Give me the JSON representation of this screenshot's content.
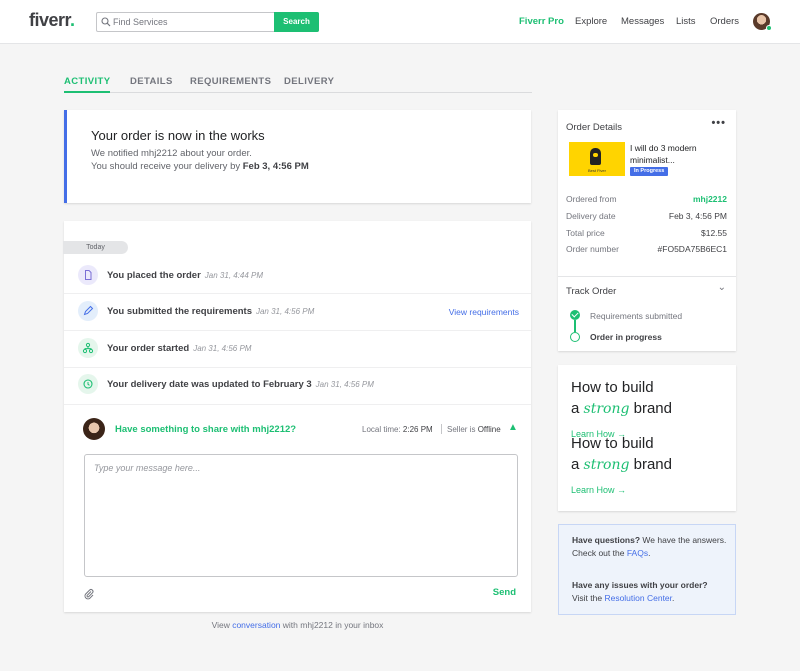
{
  "header": {
    "logo": "fiverr",
    "logo_dot": ".",
    "search_placeholder": "Find Services",
    "search_button": "Search",
    "nav": [
      "Fiverr Pro",
      "Explore",
      "Messages",
      "Lists",
      "Orders"
    ]
  },
  "tabs": [
    "ACTIVITY",
    "DETAILS",
    "REQUIREMENTS",
    "DELIVERY"
  ],
  "status": {
    "title": "Your order is now in the works",
    "line1": "We notified mhj2212 about your order.",
    "line2_prefix": "You should receive your delivery by ",
    "line2_date": "Feb 3, 4:56 PM"
  },
  "activity": {
    "day_label": "Today",
    "events": [
      {
        "text": "You placed the order",
        "date": "Jan 31, 4:44 PM",
        "icon": "document-icon"
      },
      {
        "text": "You submitted the requirements",
        "date": "Jan 31, 4:56 PM",
        "icon": "pencil-icon",
        "link": "View requirements"
      },
      {
        "text": "Your order started",
        "date": "Jan 31, 4:56 PM",
        "icon": "hierarchy-icon"
      },
      {
        "text": "Your delivery date was updated to February 3",
        "date": "Jan 31, 4:56 PM",
        "icon": "clock-icon"
      }
    ],
    "message": {
      "prompt": "Have something to share with mhj2212?",
      "local_time_label": "Local time:",
      "local_time": "2:26 PM",
      "seller_label": "Seller is",
      "seller_status": "Offline",
      "placeholder": "Type your message here...",
      "send": "Send"
    },
    "inbox_prefix": "View ",
    "inbox_link": "conversation",
    "inbox_suffix": " with mhj2212 in your inbox"
  },
  "order": {
    "header": "Order Details",
    "more": "•••",
    "gig_title": "I will do 3 modern minimalist...",
    "gig_thumb_caption": "Best Fiver",
    "badge": "In Progress",
    "rows": [
      {
        "k": "Ordered from",
        "v": "mhj2212"
      },
      {
        "k": "Delivery date",
        "v": "Feb 3, 4:56 PM"
      },
      {
        "k": "Total price",
        "v": "$12.55"
      },
      {
        "k": "Order number",
        "v": "#FO5DA75B6EC1"
      }
    ],
    "track": "Track Order",
    "steps": [
      "Requirements submitted",
      "Order in progress"
    ]
  },
  "promo": {
    "line1": "How to build",
    "line2_a": "a ",
    "line2_em": "strong",
    "line2_b": " brand",
    "link": "Learn How →"
  },
  "help": {
    "q1_bold": "Have questions?",
    "q1_rest": " We have the answers.",
    "q1_pre": "Check out the ",
    "q1_link": "FAQs",
    "q1_post": ".",
    "q2_bold": "Have any issues with your order?",
    "q2_pre": "Visit the ",
    "q2_link": "Resolution Center",
    "q2_post": "."
  },
  "colors": {
    "accent": "#1dbf73",
    "link": "#446ee7"
  }
}
